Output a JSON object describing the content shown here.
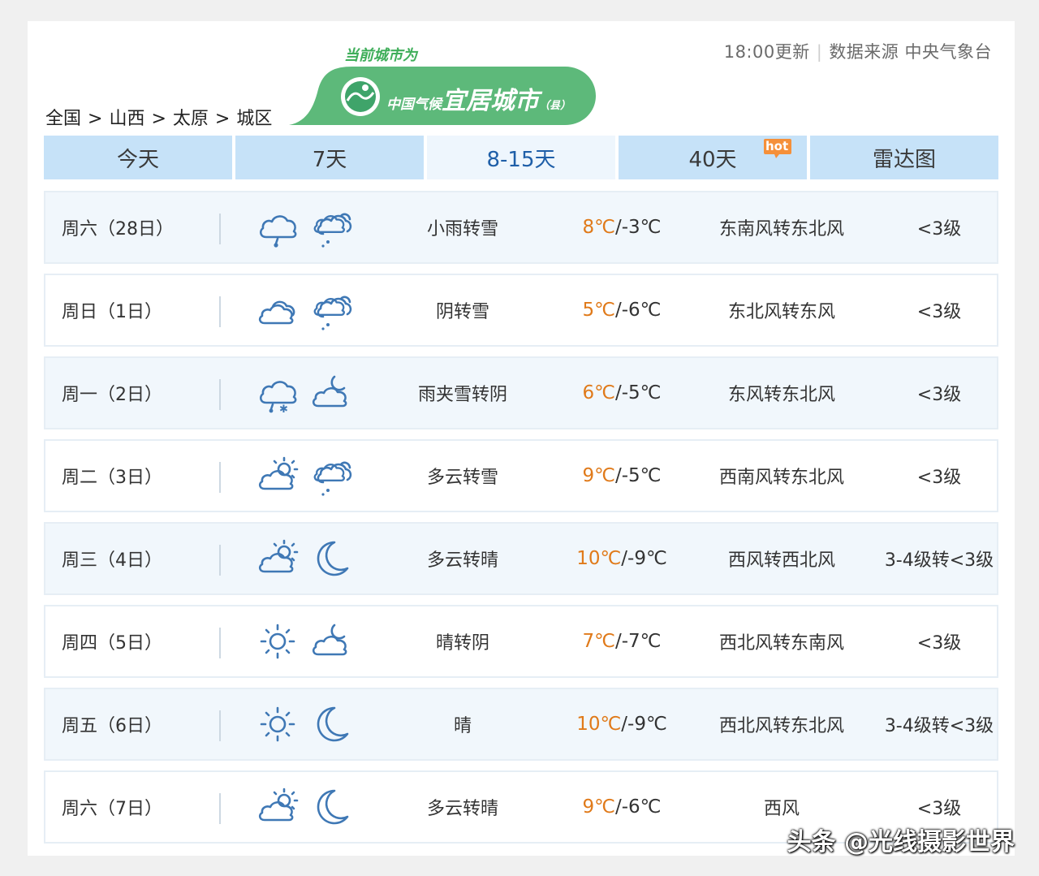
{
  "header": {
    "update_time": "18:00更新",
    "source": "数据来源 中央气象台",
    "breadcrumb": [
      "全国",
      "山西",
      "太原",
      "城区"
    ],
    "breadcrumb_sep": ">",
    "promo_tag": "当前城市为",
    "promo_small": "中国气候",
    "promo_big": "宜居城市",
    "promo_suffix": "（县）"
  },
  "tabs": [
    {
      "label": "今天",
      "active": false
    },
    {
      "label": "7天",
      "active": false
    },
    {
      "label": "8-15天",
      "active": true
    },
    {
      "label": "40天",
      "active": false,
      "badge": "hot"
    },
    {
      "label": "雷达图",
      "active": false
    }
  ],
  "forecast": [
    {
      "day": "周六（28日）",
      "icon_day": "rain-cloud-icon",
      "icon_night": "snow-cloud-icon",
      "desc": "小雨转雪",
      "high": "8℃",
      "low": "/-3℃",
      "wind": "东南风转东北风",
      "level": "<3级"
    },
    {
      "day": "周日（1日）",
      "icon_day": "overcast-icon",
      "icon_night": "snow-cloud-icon",
      "desc": "阴转雪",
      "high": "5℃",
      "low": "/-6℃",
      "wind": "东北风转东风",
      "level": "<3级"
    },
    {
      "day": "周一（2日）",
      "icon_day": "sleet-cloud-icon",
      "icon_night": "cloudy-night-icon",
      "desc": "雨夹雪转阴",
      "high": "6℃",
      "low": "/-5℃",
      "wind": "东风转东北风",
      "level": "<3级"
    },
    {
      "day": "周二（3日）",
      "icon_day": "partly-cloudy-icon",
      "icon_night": "snow-cloud-icon",
      "desc": "多云转雪",
      "high": "9℃",
      "low": "/-5℃",
      "wind": "西南风转东北风",
      "level": "<3级"
    },
    {
      "day": "周三（4日）",
      "icon_day": "partly-cloudy-icon",
      "icon_night": "moon-icon",
      "desc": "多云转晴",
      "high": "10℃",
      "low": "/-9℃",
      "wind": "西风转西北风",
      "level": "3-4级转<3级"
    },
    {
      "day": "周四（5日）",
      "icon_day": "sun-icon",
      "icon_night": "cloudy-night-icon",
      "desc": "晴转阴",
      "high": "7℃",
      "low": "/-7℃",
      "wind": "西北风转东南风",
      "level": "<3级"
    },
    {
      "day": "周五（6日）",
      "icon_day": "sun-icon",
      "icon_night": "moon-icon",
      "desc": "晴",
      "high": "10℃",
      "low": "/-9℃",
      "wind": "西北风转东北风",
      "level": "3-4级转<3级"
    },
    {
      "day": "周六（7日）",
      "icon_day": "partly-cloudy-icon",
      "icon_night": "moon-icon",
      "desc": "多云转晴",
      "high": "9℃",
      "low": "/-6℃",
      "wind": "西风",
      "level": "<3级"
    }
  ],
  "watermark": "头条 @光线摄影世界",
  "colors": {
    "tab_bg": "#c6e2f8",
    "tab_active_text": "#1f5fa8",
    "high_temp": "#e07a1a",
    "icon_stroke": "#3f78b5",
    "promo_green": "#5db97a"
  }
}
